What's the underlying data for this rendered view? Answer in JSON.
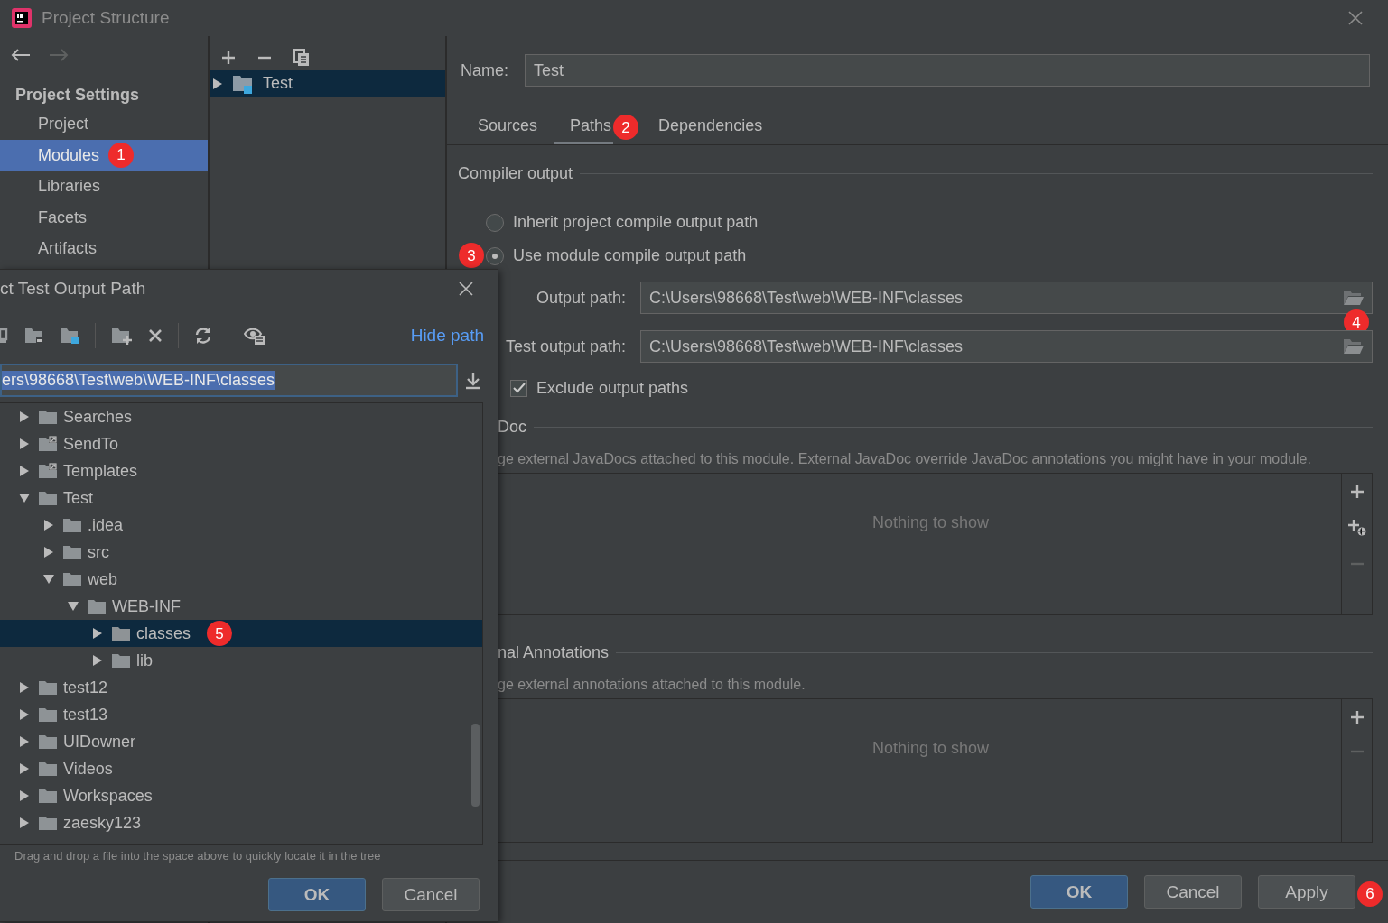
{
  "window": {
    "title": "Project Structure"
  },
  "sidebar": {
    "heading": "Project Settings",
    "items": [
      {
        "label": "Project",
        "selected": false
      },
      {
        "label": "Modules",
        "selected": true,
        "badge": "1"
      },
      {
        "label": "Libraries",
        "selected": false
      },
      {
        "label": "Facets",
        "selected": false
      },
      {
        "label": "Artifacts",
        "selected": false
      }
    ]
  },
  "modules": {
    "items": [
      {
        "label": "Test",
        "selected": true
      }
    ]
  },
  "name_field": {
    "label": "Name:",
    "value": "Test"
  },
  "tabs": [
    {
      "label": "Sources",
      "selected": false
    },
    {
      "label": "Paths",
      "selected": true,
      "badge": "2"
    },
    {
      "label": "Dependencies",
      "selected": false
    }
  ],
  "compiler_output": {
    "heading": "Compiler output",
    "options": [
      {
        "label": "Inherit project compile output path",
        "selected": false
      },
      {
        "label": "Use module compile output path",
        "selected": true,
        "badge": "3"
      }
    ],
    "paths": [
      {
        "label": "Output path:",
        "value": "C:\\Users\\98668\\Test\\web\\WEB-INF\\classes",
        "badge": "4"
      },
      {
        "label": "Test output path:",
        "value": "C:\\Users\\98668\\Test\\web\\WEB-INF\\classes"
      }
    ],
    "exclude": {
      "label": "Exclude output paths",
      "checked": true
    }
  },
  "javadoc": {
    "heading": "Doc",
    "description": "ge external JavaDocs attached to this module. External JavaDoc override JavaDoc annotations you might have in your module.",
    "empty_text": "Nothing to show"
  },
  "annotations": {
    "heading": "nal Annotations",
    "description": "ge external annotations attached to this module.",
    "empty_text": "Nothing to show"
  },
  "buttons": [
    {
      "label": "OK",
      "kind": "primary"
    },
    {
      "label": "Cancel",
      "kind": "normal"
    },
    {
      "label": "Apply",
      "kind": "normal",
      "badge": "6"
    }
  ],
  "dialog": {
    "title": "ct Test Output Path",
    "hide_path": "Hide path",
    "path_value": "ers\\98668\\Test\\web\\WEB-INF\\classes",
    "tree": [
      {
        "label": "Searches",
        "kind": "folder",
        "expanded": false,
        "selected": false
      },
      {
        "label": "SendTo",
        "kind": "shortcut",
        "expanded": false,
        "selected": false
      },
      {
        "label": "Templates",
        "kind": "shortcut",
        "expanded": false,
        "selected": false
      },
      {
        "label": "Test",
        "kind": "folder",
        "expanded": true,
        "selected": false,
        "children": [
          {
            "label": ".idea",
            "kind": "folder",
            "expanded": false,
            "selected": false
          },
          {
            "label": "src",
            "kind": "folder",
            "expanded": false,
            "selected": false
          },
          {
            "label": "web",
            "kind": "folder",
            "expanded": true,
            "selected": false,
            "children": [
              {
                "label": "WEB-INF",
                "kind": "folder",
                "expanded": true,
                "selected": false,
                "children": [
                  {
                    "label": "classes",
                    "kind": "folder",
                    "expanded": false,
                    "selected": true,
                    "badge": "5"
                  },
                  {
                    "label": "lib",
                    "kind": "folder",
                    "expanded": false,
                    "selected": false
                  }
                ]
              }
            ]
          }
        ]
      },
      {
        "label": "test12",
        "kind": "folder",
        "expanded": false,
        "selected": false
      },
      {
        "label": "test13",
        "kind": "folder",
        "expanded": false,
        "selected": false
      },
      {
        "label": "UIDowner",
        "kind": "folder",
        "expanded": false,
        "selected": false
      },
      {
        "label": "Videos",
        "kind": "folder",
        "expanded": false,
        "selected": false
      },
      {
        "label": "Workspaces",
        "kind": "folder",
        "expanded": false,
        "selected": false
      },
      {
        "label": "zaesky123",
        "kind": "folder",
        "expanded": false,
        "selected": false
      }
    ],
    "hint": "Drag and drop a file into the space above to quickly locate it in the tree",
    "buttons": [
      {
        "label": "OK",
        "kind": "primary"
      },
      {
        "label": "Cancel",
        "kind": "normal"
      }
    ]
  }
}
